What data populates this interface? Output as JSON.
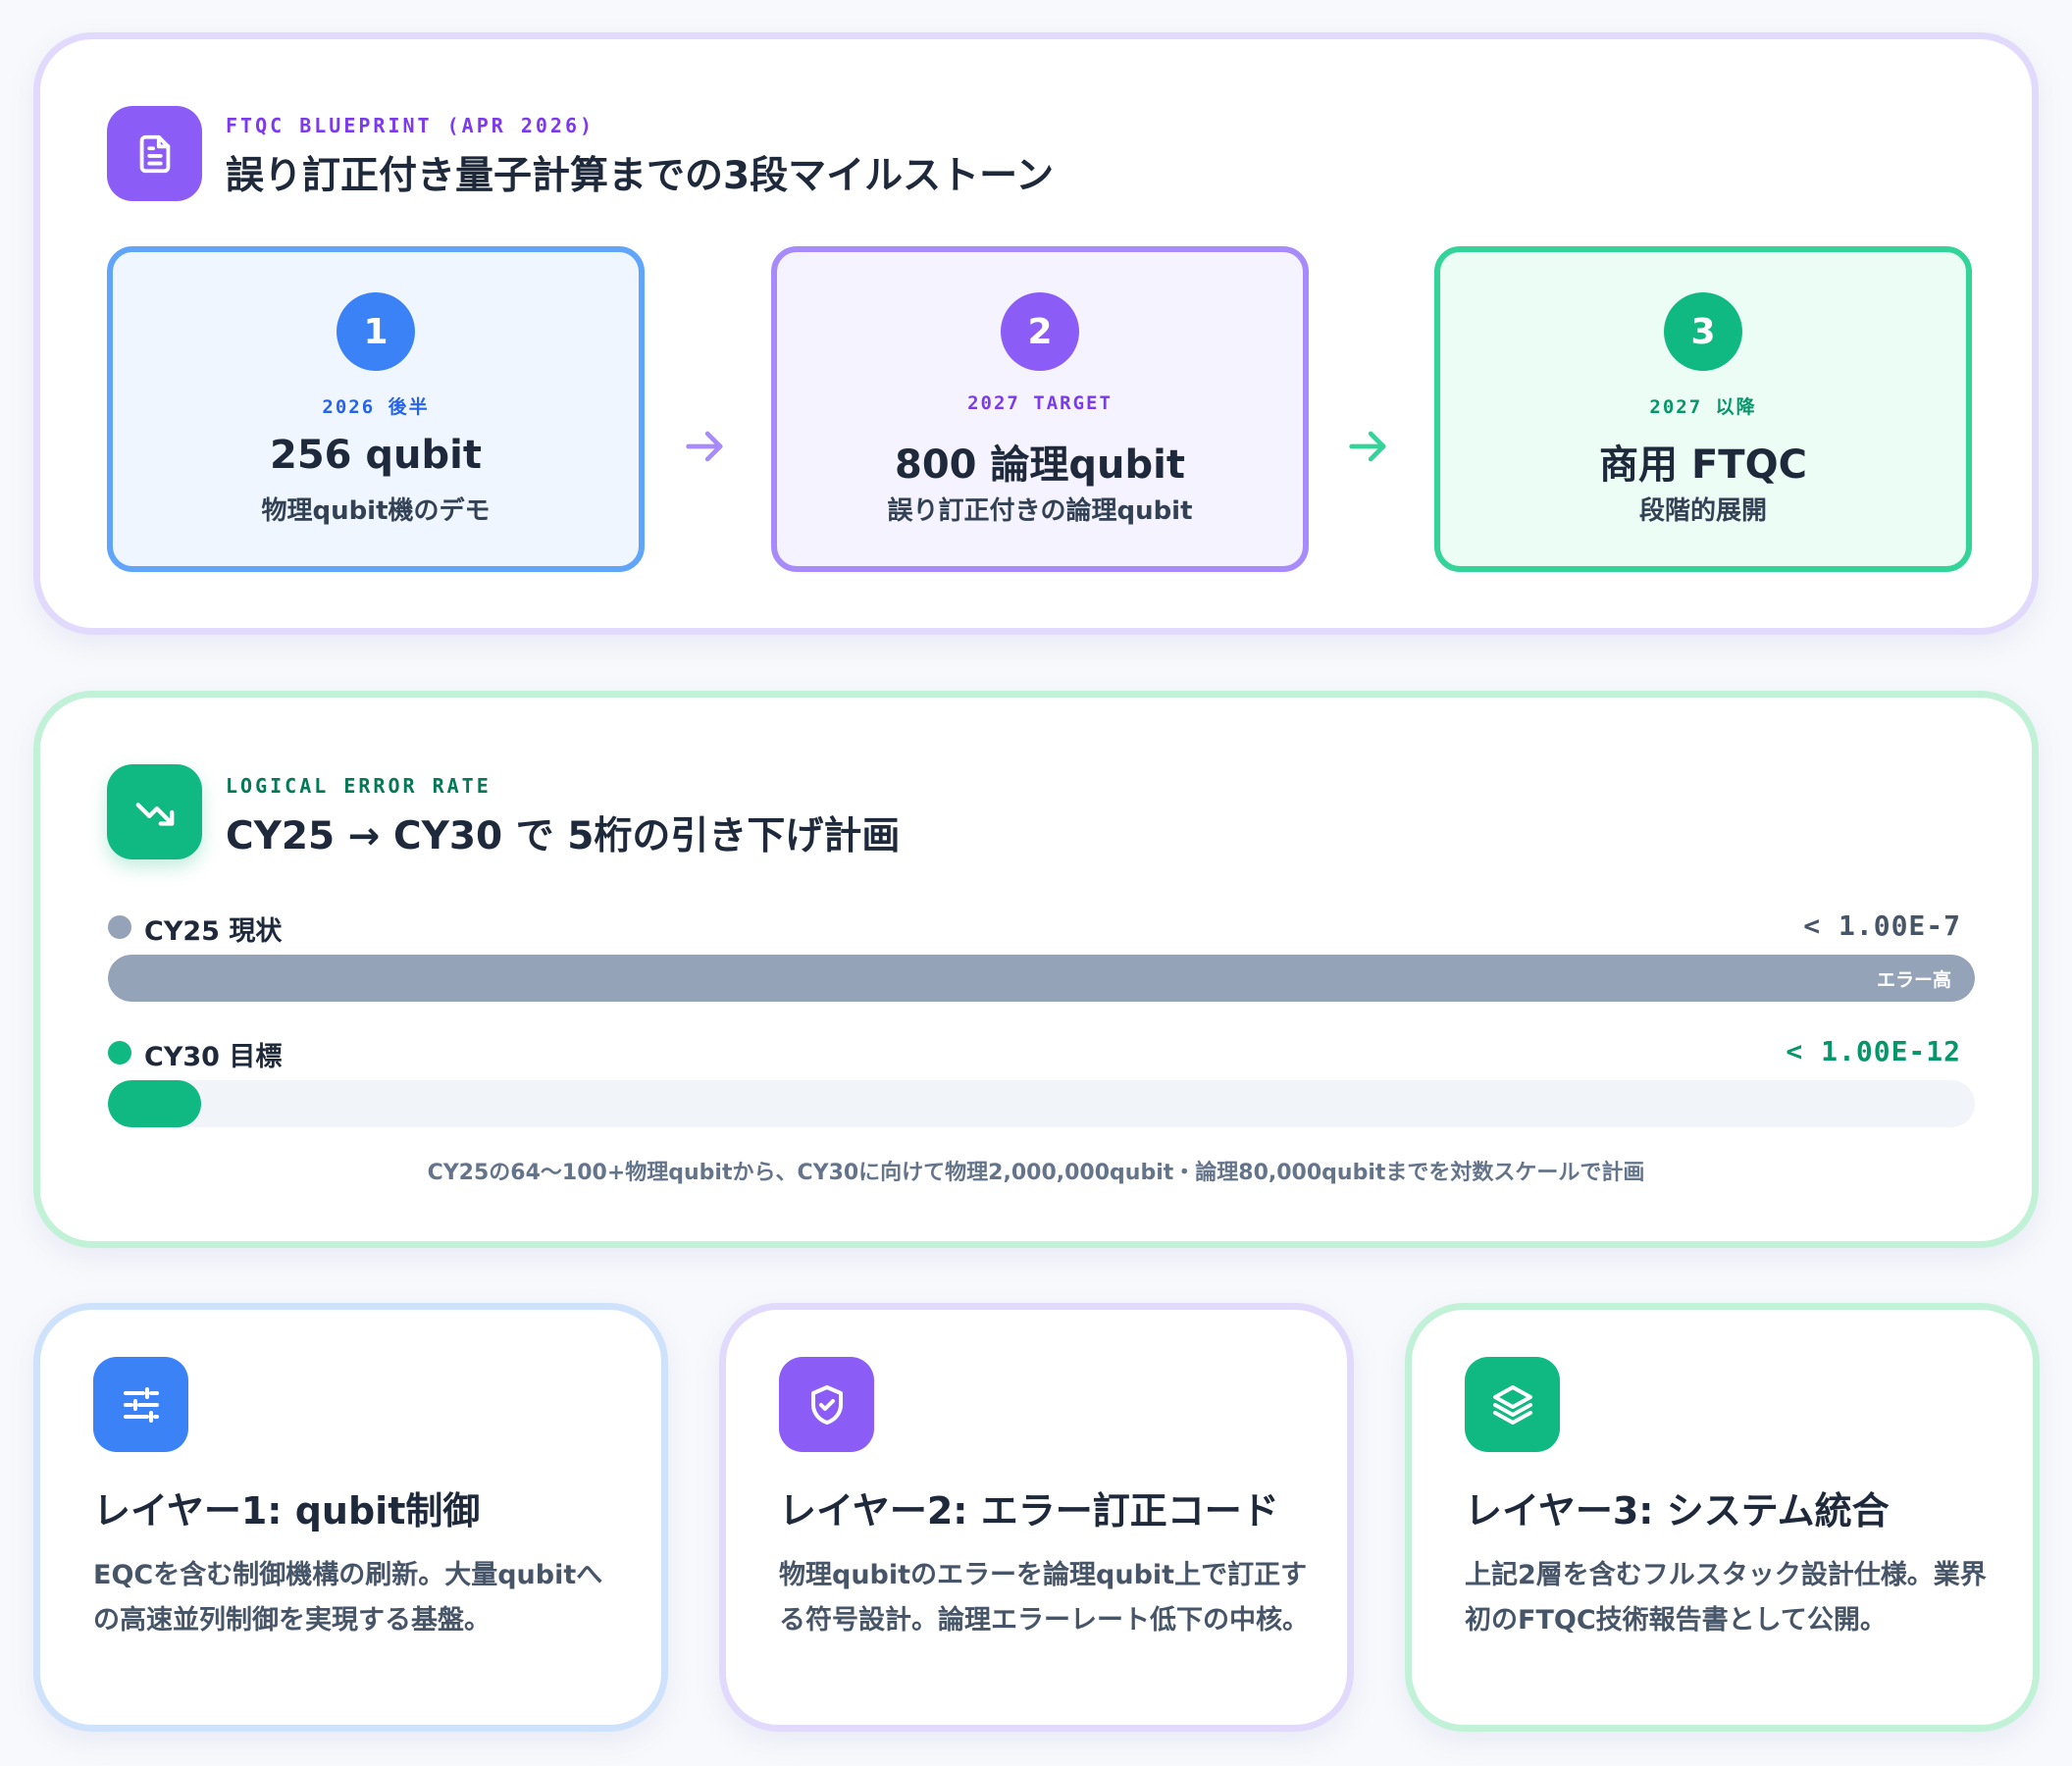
{
  "blueprint": {
    "kicker": "FTQC BLUEPRINT (APR 2026)",
    "title": "誤り訂正付き量子計算までの3段マイルストーン",
    "icon": "document-icon",
    "milestones": [
      {
        "num": "1",
        "period": "2026 後半",
        "value": "256 qubit",
        "desc": "物理qubit機のデモ",
        "color": "#3b82f6"
      },
      {
        "num": "2",
        "period": "2027 TARGET",
        "value": "800 論理qubit",
        "desc": "誤り訂正付きの論理qubit",
        "color": "#8b5cf6"
      },
      {
        "num": "3",
        "period": "2027 以降",
        "value": "商用 FTQC",
        "desc": "段階的展開",
        "color": "#10b981"
      }
    ]
  },
  "error_rate": {
    "kicker": "LOGICAL ERROR RATE",
    "title": "CY25 → CY30 で 5桁の引き下げ計画",
    "icon": "trending-down-icon",
    "current": {
      "label": "CY25 現状",
      "value": "< 1.00E-7",
      "level": 1.0,
      "tag": "エラー高",
      "color": "#94a3b8"
    },
    "target": {
      "label": "CY30 目標",
      "value": "< 1.00E-12",
      "level": 0.05,
      "color": "#10b981"
    },
    "note": "CY25の64〜100+物理qubitから、CY30に向けて物理2,000,000qubit・論理80,000qubitまでを対数スケールで計画"
  },
  "layers": [
    {
      "title": "レイヤー1: qubit制御",
      "desc": "EQCを含む制御機構の刷新。大量qubitへの高速並列制御を実現する基盤。",
      "icon": "sliders-icon",
      "color": "#3b82f6"
    },
    {
      "title": "レイヤー2: エラー訂正コード",
      "desc": "物理qubitのエラーを論理qubit上で訂正する符号設計。論理エラーレート低下の中核。",
      "icon": "shield-check-icon",
      "color": "#8b5cf6"
    },
    {
      "title": "レイヤー3: システム統合",
      "desc": "上記2層を含むフルスタック設計仕様。業界初のFTQC技術報告書として公開。",
      "icon": "layers-icon",
      "color": "#10b981"
    }
  ]
}
